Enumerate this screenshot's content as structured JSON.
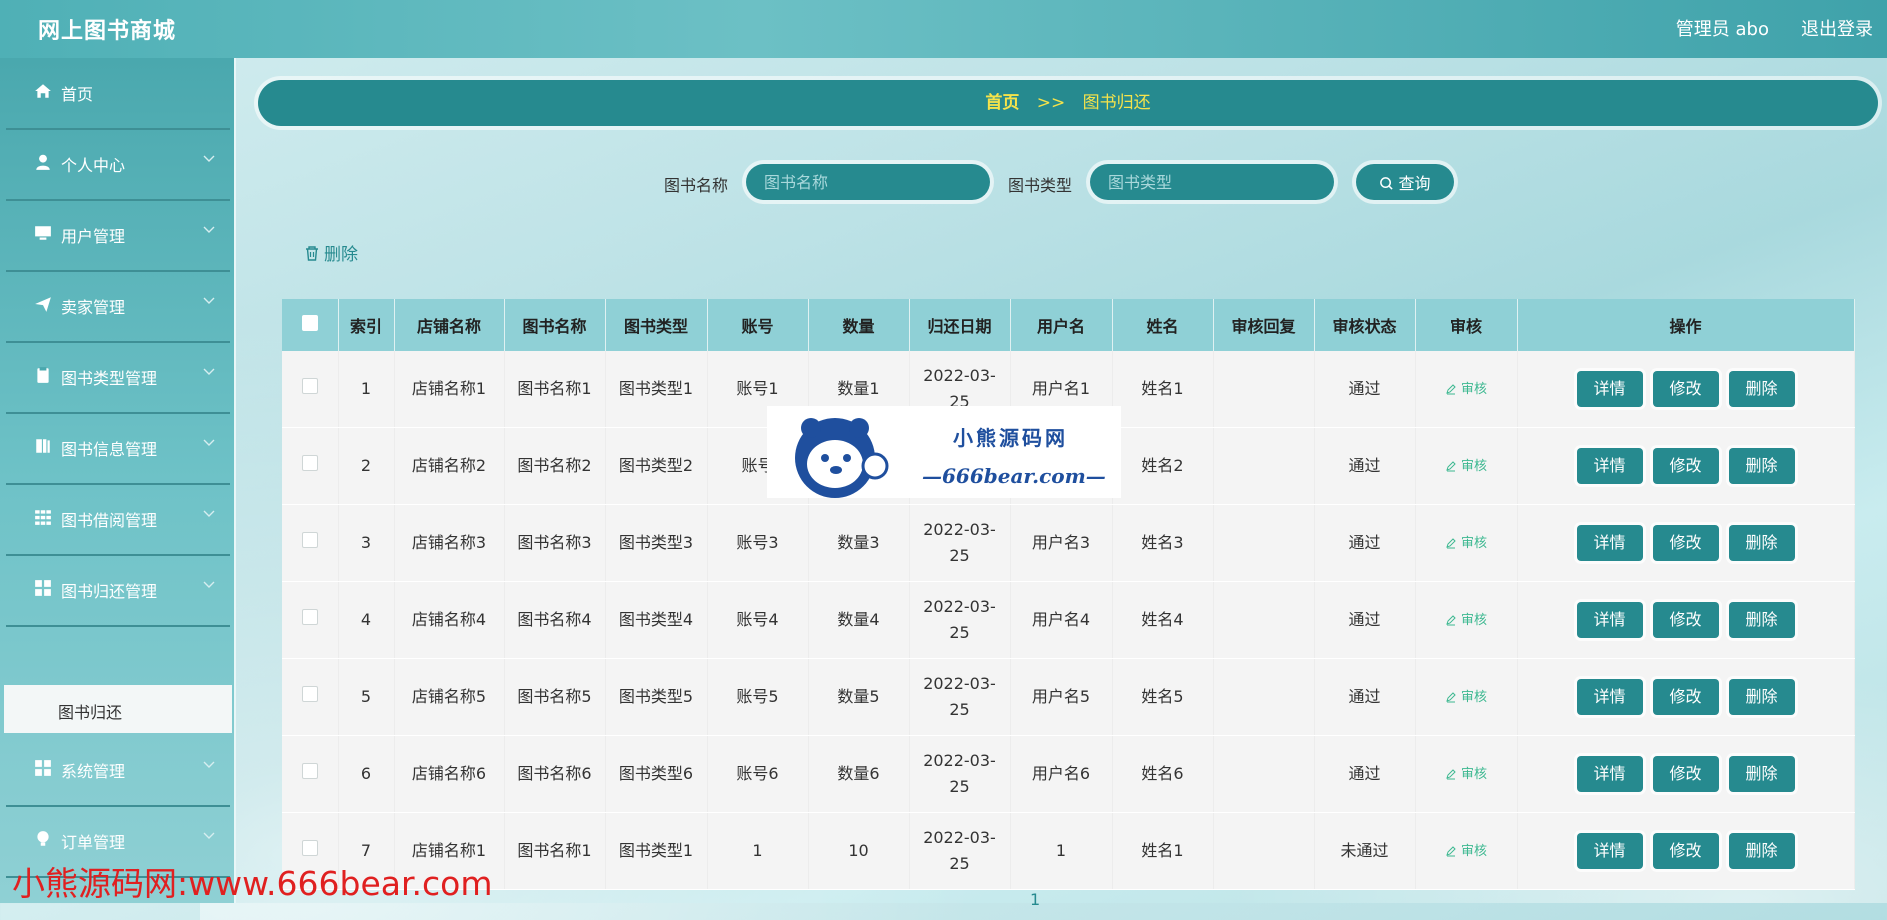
{
  "header": {
    "app_title": "网上图书商城",
    "admin_label": "管理员 abo",
    "logout_label": "退出登录"
  },
  "sidebar": {
    "items": [
      {
        "label": "首页",
        "icon": "home-icon"
      },
      {
        "label": "个人中心",
        "icon": "user-icon"
      },
      {
        "label": "用户管理",
        "icon": "monitor-icon"
      },
      {
        "label": "卖家管理",
        "icon": "send-icon"
      },
      {
        "label": "图书类型管理",
        "icon": "clipboard-icon"
      },
      {
        "label": "图书信息管理",
        "icon": "book-icon"
      },
      {
        "label": "图书借阅管理",
        "icon": "grid-icon"
      },
      {
        "label": "图书归还管理",
        "icon": "apps-icon"
      },
      {
        "label": "系统管理",
        "icon": "apps-icon"
      },
      {
        "label": "订单管理",
        "icon": "bulb-icon"
      }
    ],
    "active_sub": "图书归还"
  },
  "breadcrumb": {
    "home": "首页",
    "separator": ">>",
    "current": "图书归还"
  },
  "search": {
    "name_label": "图书名称",
    "name_placeholder": "图书名称",
    "type_label": "图书类型",
    "type_placeholder": "图书类型",
    "query_label": "查询"
  },
  "toolbar": {
    "delete_label": "删除"
  },
  "table": {
    "columns": [
      "索引",
      "店铺名称",
      "图书名称",
      "图书类型",
      "账号",
      "数量",
      "归还日期",
      "用户名",
      "姓名",
      "审核回复",
      "审核状态",
      "审核",
      "操作"
    ],
    "audit_label": "审核",
    "actions": {
      "detail": "详情",
      "edit": "修改",
      "delete": "删除"
    },
    "rows": [
      {
        "index": "1",
        "shop": "店铺名称1",
        "book": "图书名称1",
        "type": "图书类型1",
        "account": "账号1",
        "qty": "数量1",
        "date_a": "2022-03-",
        "date_b": "25",
        "username": "用户名1",
        "name": "姓名1",
        "reply": "",
        "status": "通过"
      },
      {
        "index": "2",
        "shop": "店铺名称2",
        "book": "图书名称2",
        "type": "图书类型2",
        "account": "账号",
        "qty": "",
        "date_a": "",
        "date_b": "",
        "username": "",
        "name": "姓名2",
        "reply": "",
        "status": "通过"
      },
      {
        "index": "3",
        "shop": "店铺名称3",
        "book": "图书名称3",
        "type": "图书类型3",
        "account": "账号3",
        "qty": "数量3",
        "date_a": "2022-03-",
        "date_b": "25",
        "username": "用户名3",
        "name": "姓名3",
        "reply": "",
        "status": "通过"
      },
      {
        "index": "4",
        "shop": "店铺名称4",
        "book": "图书名称4",
        "type": "图书类型4",
        "account": "账号4",
        "qty": "数量4",
        "date_a": "2022-03-",
        "date_b": "25",
        "username": "用户名4",
        "name": "姓名4",
        "reply": "",
        "status": "通过"
      },
      {
        "index": "5",
        "shop": "店铺名称5",
        "book": "图书名称5",
        "type": "图书类型5",
        "account": "账号5",
        "qty": "数量5",
        "date_a": "2022-03-",
        "date_b": "25",
        "username": "用户名5",
        "name": "姓名5",
        "reply": "",
        "status": "通过"
      },
      {
        "index": "6",
        "shop": "店铺名称6",
        "book": "图书名称6",
        "type": "图书类型6",
        "account": "账号6",
        "qty": "数量6",
        "date_a": "2022-03-",
        "date_b": "25",
        "username": "用户名6",
        "name": "姓名6",
        "reply": "",
        "status": "通过"
      },
      {
        "index": "7",
        "shop": "店铺名称1",
        "book": "图书名称1",
        "type": "图书类型1",
        "account": "1",
        "qty": "10",
        "date_a": "2022-03-",
        "date_b": "25",
        "username": "1",
        "name": "姓名1",
        "reply": "",
        "status": "未通过"
      }
    ]
  },
  "pagination": {
    "current_page": "1"
  },
  "watermark": {
    "logo_title": "小熊源码网",
    "logo_url": "—666bear.com—",
    "footer_text": "小熊源码网:www.666bear.com"
  },
  "colors": {
    "primary": "#268a8f",
    "breadcrumb_text": "#f5e34b",
    "audit": "#3cb890",
    "watermark_red": "#e02020"
  }
}
